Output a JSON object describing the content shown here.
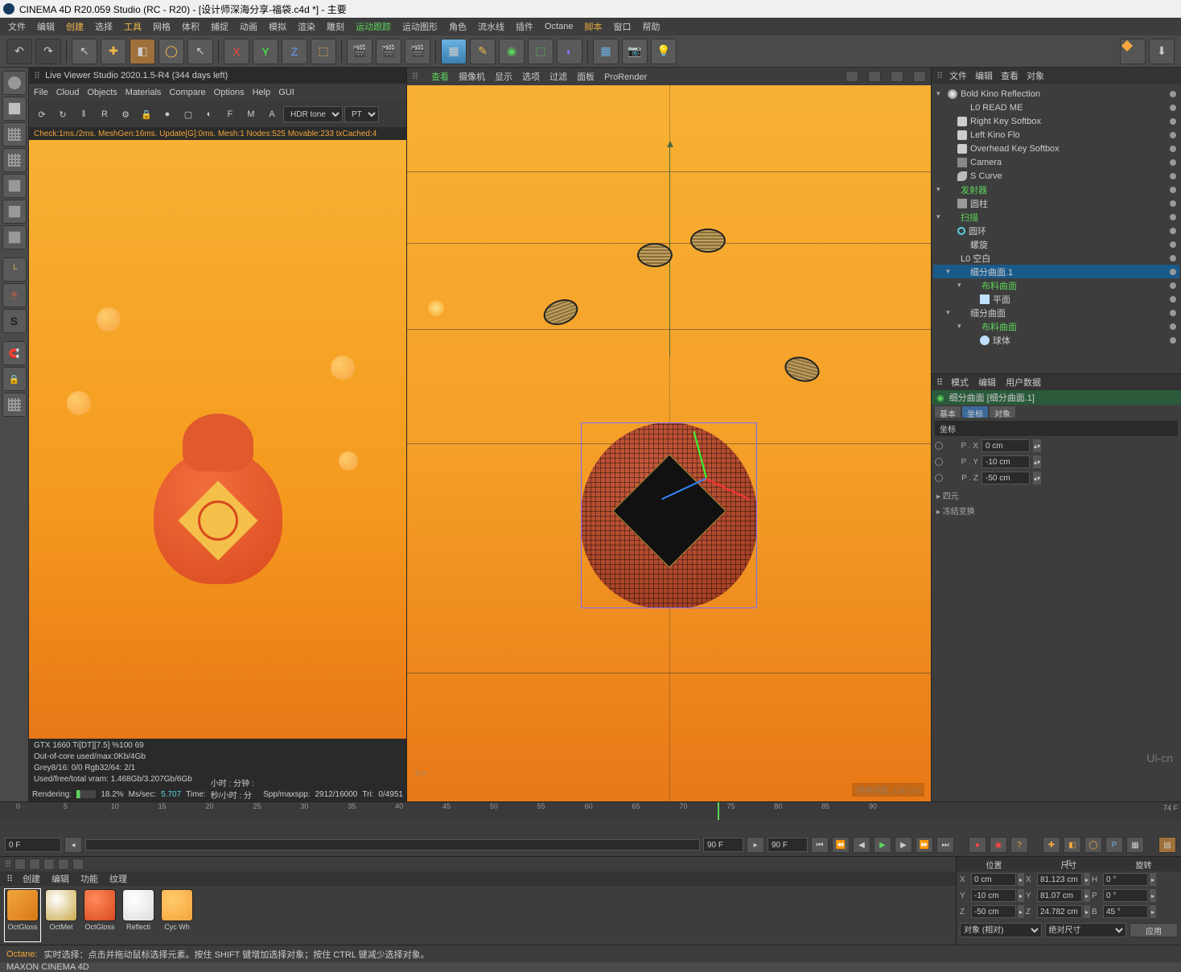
{
  "title": "CINEMA 4D R20.059 Studio (RC - R20) - [设计师深海分享-福袋.c4d *] - 主要",
  "mainmenu": [
    "文件",
    "编辑",
    "创建",
    "选择",
    "工具",
    "网格",
    "体积",
    "捕捉",
    "动画",
    "模拟",
    "渲染",
    "雕刻",
    "运动跟踪",
    "运动图形",
    "角色",
    "流水线",
    "插件",
    "Octane",
    "脚本",
    "窗口",
    "帮助"
  ],
  "liveviewer": {
    "header": "Live Viewer Studio 2020.1.5-R4 (344 days left)",
    "menu": [
      "File",
      "Cloud",
      "Objects",
      "Materials",
      "Compare",
      "Options",
      "Help",
      "GUI"
    ],
    "hdr": "HDR tone",
    "pt": "PT",
    "status": "Check:1ms./2ms.  MeshGen:16ms.  Update[G]:0ms.  Mesh:1 Nodes:525 Movable:233 txCached:4",
    "stats": {
      "gpu": "GTX 1660 Ti[DT][7.5]       %100      69",
      "oom": "Out-of-core used/max:0Kb/4Gb",
      "grey": "Grey8/16: 0/0        Rgb32/64: 2/1",
      "vram": "Used/free/total vram: 1.468Gb/3.207Gb/6Gb",
      "render_label": "Rendering:",
      "render_pct": "18.2%",
      "mssec_label": "Ms/sec:",
      "mssec": "5.707",
      "time_label": "Time:",
      "time": "小时 : 分钟 : 秒/小时 : 分钟 : 秒",
      "spp_label": "Spp/maxspp:",
      "spp": "2912/16000",
      "tri_label": "Tri:",
      "tri": "0/4951"
    }
  },
  "viewport": {
    "menu": [
      "查看",
      "摄像机",
      "显示",
      "选项",
      "过滤",
      "面板",
      "ProRender"
    ],
    "scale": "网格间距: 100 cm"
  },
  "objtabs": [
    "文件",
    "编辑",
    "查看",
    "对象"
  ],
  "tree": [
    {
      "d": 0,
      "tw": "▾",
      "ico": "sun",
      "label": "Bold Kino Reflection"
    },
    {
      "d": 1,
      "tw": "",
      "ico": "null",
      "label": "L0 READ ME"
    },
    {
      "d": 1,
      "tw": "",
      "ico": "light",
      "label": "Right Key Softbox"
    },
    {
      "d": 1,
      "tw": "",
      "ico": "light",
      "label": "Left Kino Flo"
    },
    {
      "d": 1,
      "tw": "",
      "ico": "light",
      "label": "Overhead Key Softbox"
    },
    {
      "d": 1,
      "tw": "",
      "ico": "cam",
      "label": "Camera"
    },
    {
      "d": 1,
      "tw": "",
      "ico": "curve",
      "label": "S Curve"
    },
    {
      "d": 0,
      "tw": "▾",
      "ico": "null",
      "label": "发射器",
      "c": "#5bd35b"
    },
    {
      "d": 1,
      "tw": "",
      "ico": "cyl",
      "label": "圆柱"
    },
    {
      "d": 0,
      "tw": "▾",
      "ico": "null",
      "label": "扫描",
      "c": "#5bd35b"
    },
    {
      "d": 1,
      "tw": "",
      "ico": "ring",
      "label": "圆环"
    },
    {
      "d": 1,
      "tw": "",
      "ico": "spiral",
      "label": "螺旋"
    },
    {
      "d": 0,
      "tw": "",
      "ico": "null",
      "label": "L0 空白"
    },
    {
      "d": 1,
      "tw": "▾",
      "ico": "subd",
      "label": "细分曲面.1",
      "sel": true
    },
    {
      "d": 2,
      "tw": "▾",
      "ico": "null",
      "label": "布料曲面",
      "c": "#5bd35b"
    },
    {
      "d": 3,
      "tw": "",
      "ico": "plane",
      "label": "平面"
    },
    {
      "d": 1,
      "tw": "▾",
      "ico": "subd",
      "label": "细分曲面"
    },
    {
      "d": 2,
      "tw": "▾",
      "ico": "null",
      "label": "布料曲面",
      "c": "#5bd35b"
    },
    {
      "d": 3,
      "tw": "",
      "ico": "sphere",
      "label": "球体"
    }
  ],
  "attr": {
    "tabs": [
      "模式",
      "编辑",
      "用户数据"
    ],
    "header": "细分曲面 [细分曲面.1]",
    "subtabs": [
      "基本",
      "坐标",
      "对象"
    ],
    "group": "坐标",
    "rows": [
      {
        "ax": "P . X",
        "val": "0 cm"
      },
      {
        "ax": "P . Y",
        "val": "-10 cm"
      },
      {
        "ax": "P . Z",
        "val": "-50 cm"
      }
    ],
    "collapse": [
      "四元",
      "冻结变换"
    ]
  },
  "timeline": {
    "start": "0 F",
    "cur": "0 F",
    "end1": "90 F",
    "end2": "90 F",
    "marker_frame": 74,
    "total": "74 F",
    "ticks": [
      0,
      5,
      10,
      15,
      20,
      25,
      30,
      35,
      40,
      45,
      50,
      55,
      60,
      65,
      70,
      75,
      80,
      85,
      90
    ]
  },
  "materials": {
    "tabs": [
      "创建",
      "编辑",
      "功能",
      "纹理"
    ],
    "items": [
      {
        "name": "OctGloss",
        "c": "linear-gradient(135deg,#f2a63d,#d87817)",
        "sel": true
      },
      {
        "name": "OctMet",
        "c": "radial-gradient(circle at 35% 30%,#fff,#c9a94a)"
      },
      {
        "name": "OctGloss",
        "c": "radial-gradient(circle at 35% 30%,#ff8a5c,#d84a1e)"
      },
      {
        "name": "Reflecti",
        "c": "radial-gradient(circle at 35% 30%,#fff,#ddd)"
      },
      {
        "name": "Cyc Wh",
        "c": "radial-gradient(circle at 35% 30%,#ffcb6b,#f5a43d)"
      }
    ]
  },
  "coord": {
    "headers": [
      "位置",
      "尺寸",
      "旋转"
    ],
    "rows": [
      {
        "ax": "X",
        "p": "0 cm",
        "s": "81.123 cm",
        "r": "0 °",
        "rl": "H"
      },
      {
        "ax": "Y",
        "p": "-10 cm",
        "s": "81.07 cm",
        "r": "0 °",
        "rl": "P"
      },
      {
        "ax": "Z",
        "p": "-50 cm",
        "s": "24.782 cm",
        "r": "45 °",
        "rl": "B"
      }
    ],
    "mode1": "对象 (相对)",
    "mode2": "绝对尺寸",
    "apply": "应用"
  },
  "status": {
    "oc": "Octane:",
    "txt": "实时选择：点击并拖动鼠标选择元素。按住 SHIFT 键增加选择对象；按住 CTRL 键减少选择对象。"
  },
  "watermark": "Ui-cn"
}
